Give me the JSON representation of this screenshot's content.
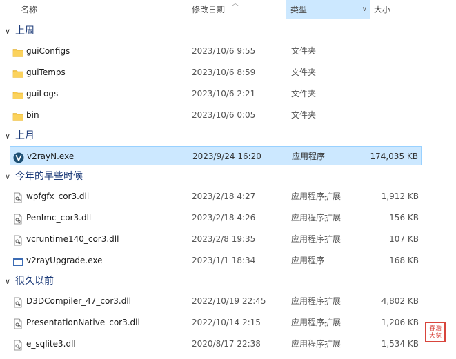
{
  "columns": {
    "name": "名称",
    "date": "修改日期",
    "type": "类型",
    "size": "大小"
  },
  "groups": [
    {
      "label": "上周",
      "items": [
        {
          "name": "guiConfigs",
          "date": "2023/10/6 9:55",
          "type": "文件夹",
          "size": "",
          "icon": "folder-icon"
        },
        {
          "name": "guiTemps",
          "date": "2023/10/6 8:59",
          "type": "文件夹",
          "size": "",
          "icon": "folder-icon"
        },
        {
          "name": "guiLogs",
          "date": "2023/10/6 2:21",
          "type": "文件夹",
          "size": "",
          "icon": "folder-icon"
        },
        {
          "name": "bin",
          "date": "2023/10/6 0:05",
          "type": "文件夹",
          "size": "",
          "icon": "folder-icon"
        }
      ]
    },
    {
      "label": "上月",
      "items": [
        {
          "name": "v2rayN.exe",
          "date": "2023/9/24 16:20",
          "type": "应用程序",
          "size": "174,035 KB",
          "icon": "v2rayn-app-icon"
        }
      ]
    },
    {
      "label": "今年的早些时候",
      "items": [
        {
          "name": "wpfgfx_cor3.dll",
          "date": "2023/2/18 4:27",
          "type": "应用程序扩展",
          "size": "1,912 KB",
          "icon": "dll-file-icon"
        },
        {
          "name": "PenImc_cor3.dll",
          "date": "2023/2/18 4:26",
          "type": "应用程序扩展",
          "size": "156 KB",
          "icon": "dll-file-icon"
        },
        {
          "name": "vcruntime140_cor3.dll",
          "date": "2023/2/8 19:35",
          "type": "应用程序扩展",
          "size": "107 KB",
          "icon": "dll-file-icon"
        },
        {
          "name": "v2rayUpgrade.exe",
          "date": "2023/1/1 18:34",
          "type": "应用程序",
          "size": "168 KB",
          "icon": "exe-window-icon"
        }
      ]
    },
    {
      "label": "很久以前",
      "items": [
        {
          "name": "D3DCompiler_47_cor3.dll",
          "date": "2022/10/19 22:45",
          "type": "应用程序扩展",
          "size": "4,802 KB",
          "icon": "dll-file-icon"
        },
        {
          "name": "PresentationNative_cor3.dll",
          "date": "2022/10/14 2:15",
          "type": "应用程序扩展",
          "size": "1,206 KB",
          "icon": "dll-file-icon"
        },
        {
          "name": "e_sqlite3.dll",
          "date": "2020/8/17 22:38",
          "type": "应用程序扩展",
          "size": "1,534 KB",
          "icon": "dll-file-icon"
        }
      ]
    }
  ],
  "selected": "v2rayN.exe",
  "watermark": "春浩大览",
  "colors": {
    "selection": "#cce8ff",
    "selection_border": "#99d1ff",
    "group_text": "#1f3d7a",
    "folder": "#f8c645",
    "seal": "#d8453c"
  }
}
